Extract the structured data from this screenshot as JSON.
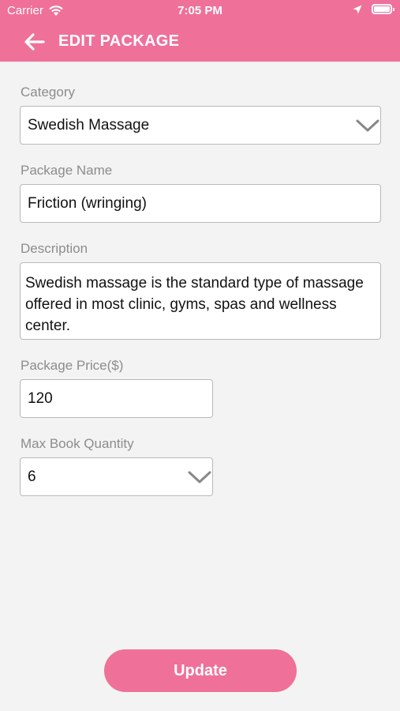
{
  "status_bar": {
    "carrier": "Carrier",
    "time": "7:05 PM"
  },
  "header": {
    "title": "EDIT PACKAGE",
    "background": "#ef7099"
  },
  "form": {
    "category": {
      "label": "Category",
      "value": "Swedish Massage"
    },
    "package_name": {
      "label": "Package Name",
      "value": "Friction (wringing)"
    },
    "description": {
      "label": "Description",
      "value": "Swedish massage is the standard type of massage offered in most clinic, gyms, spas and wellness center."
    },
    "package_price": {
      "label": "Package Price($)",
      "value": "120"
    },
    "max_book_quantity": {
      "label": "Max Book Quantity",
      "value": "6"
    }
  },
  "actions": {
    "update_label": "Update"
  }
}
